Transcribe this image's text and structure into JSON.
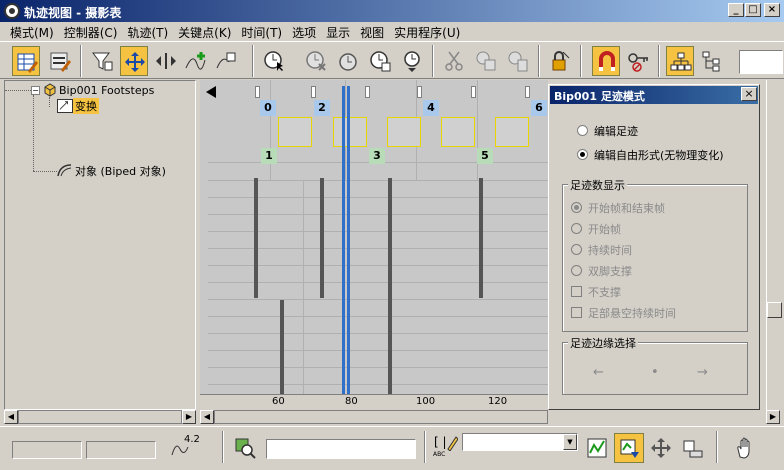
{
  "window": {
    "title": "轨迹视图 - 摄影表",
    "minimize": "_",
    "maximize": "□",
    "close": "×"
  },
  "menu": [
    "模式(M)",
    "控制器(C)",
    "轨迹(T)",
    "关键点(K)",
    "时间(T)",
    "选项",
    "显示",
    "视图",
    "实用程序(U)"
  ],
  "tree": {
    "root": "Bip001 Footsteps",
    "selected": "变换",
    "object": "对象 (Biped 对象)"
  },
  "track": {
    "footsteps_top": [
      "0",
      "2",
      "4",
      "6"
    ],
    "footsteps_bottom": [
      "1",
      "3",
      "5"
    ],
    "ruler": [
      "60",
      "80",
      "100",
      "120"
    ]
  },
  "dialog": {
    "title": "Bip001 足迹模式",
    "close": "×",
    "mode_options": [
      {
        "label": "编辑足迹",
        "selected": false
      },
      {
        "label": "编辑自由形式(无物理变化)",
        "selected": true
      }
    ],
    "display_group": "足迹数显示",
    "display_radios": [
      {
        "label": "开始帧和结束帧",
        "selected": true
      },
      {
        "label": "开始帧",
        "selected": false
      },
      {
        "label": "持续时间",
        "selected": false
      },
      {
        "label": "双脚支撑",
        "selected": false
      }
    ],
    "display_checks": [
      "不支撑",
      "足部悬空持续时间"
    ],
    "edge_group": "足迹边缘选择",
    "edge_left": "←",
    "edge_mid": "•",
    "edge_right": "→"
  },
  "statusbar": {
    "curve_value": "4.2",
    "abc_label": "ABC"
  },
  "colors": {
    "accent": "#f5c242",
    "title_bar": "#0a246a",
    "frame_line": "#3070c8"
  }
}
